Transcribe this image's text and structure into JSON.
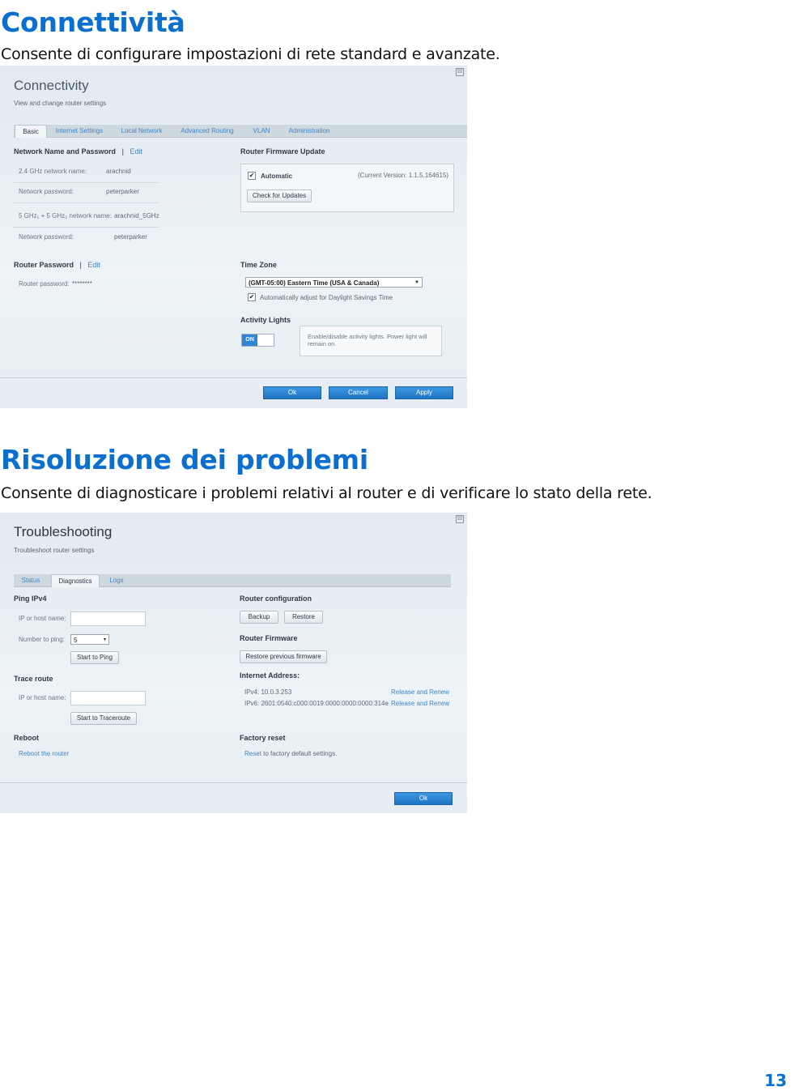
{
  "section1": {
    "heading": "Connettività",
    "description": "Consente di configurare impostazioni di rete standard e avanzate."
  },
  "connectivity": {
    "close_symbol": "☒",
    "title": "Connectivity",
    "subtitle": "View and change router settings",
    "tabs": [
      "Basic",
      "Internet Settings",
      "Local Network",
      "Advanced Routing",
      "VLAN",
      "Administration"
    ],
    "network": {
      "heading": "Network Name and Password",
      "separator": "|",
      "edit": "Edit",
      "name24_label": "2.4 GHz network name:",
      "name24_value": "arachnid",
      "pw1_label": "Network password:",
      "pw1_value": "peterparker",
      "name5_label": "5 GHz₁ + 5 GHz₂ network name:",
      "name5_value": "arachnid_5GHz",
      "pw2_label": "Network password:",
      "pw2_value": "peterparker"
    },
    "router_password": {
      "heading": "Router Password",
      "separator": "|",
      "edit": "Edit",
      "label": "Router password:",
      "value": "********"
    },
    "firmware": {
      "heading": "Router Firmware Update",
      "auto_label": "Automatic",
      "check_mark": "✔",
      "version": "(Current Version: 1.1.5.164615)",
      "check_button": "Check for Updates"
    },
    "timezone": {
      "heading": "Time Zone",
      "selected": "(GMT-05:00) Eastern Time (USA & Canada)",
      "arrow": "▼",
      "check_mark": "✔",
      "dst_label": "Automatically adjust for Daylight Savings Time"
    },
    "activity": {
      "heading": "Activity Lights",
      "toggle_label": "ON",
      "info": "Enable/disable activity lights. Power light will remain on."
    },
    "buttons": {
      "ok": "Ok",
      "cancel": "Cancel",
      "apply": "Apply"
    }
  },
  "section2": {
    "heading": "Risoluzione dei problemi",
    "description": "Consente di diagnosticare i problemi relativi al router e di verificare lo stato della rete."
  },
  "troubleshooting": {
    "close_symbol": "☒",
    "title": "Troubleshooting",
    "subtitle": "Troubleshoot router settings",
    "tabs": [
      "Status",
      "Diagnostics",
      "Logs"
    ],
    "ping": {
      "heading": "Ping IPv4",
      "host_label": "IP or host name:",
      "host_value": "",
      "count_label": "Number to ping:",
      "count_value": "5",
      "arrow": "▾",
      "start_button": "Start to Ping"
    },
    "trace": {
      "heading": "Trace route",
      "host_label": "IP or host name:",
      "host_value": "",
      "start_button": "Start to Traceroute"
    },
    "reboot": {
      "heading": "Reboot",
      "link": "Reboot the router"
    },
    "router_config": {
      "heading": "Router configuration",
      "backup": "Backup",
      "restore": "Restore"
    },
    "router_firmware": {
      "heading": "Router Firmware",
      "restore_prev": "Restore previous firmware"
    },
    "internet_address": {
      "heading": "Internet Address:",
      "ipv4": "IPv4: 10.0.3.253",
      "ipv6": "IPv6: 2601:0540:c000:0019:0000:0000:0000:314e",
      "release_renew": "Release and Renew"
    },
    "factory_reset": {
      "heading": "Factory reset",
      "reset_link": "Reset",
      "rest_text": " to factory default settings."
    },
    "ok_button": "Ok"
  },
  "page_number": "13"
}
